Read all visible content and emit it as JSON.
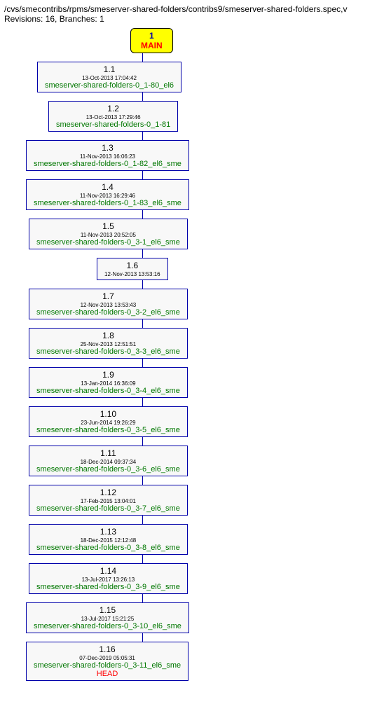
{
  "header": {
    "path": "/cvs/smecontribs/rpms/smeserver-shared-folders/contribs9/smeserver-shared-folders.spec,v",
    "meta": "Revisions: 16, Branches: 1"
  },
  "root": {
    "num": "1",
    "branch": "MAIN"
  },
  "revisions": [
    {
      "rev": "1.1",
      "ts": "13-Oct-2013 17:04:42",
      "tag": "smeserver-shared-folders-0_1-80_el6",
      "head": ""
    },
    {
      "rev": "1.2",
      "ts": "13-Oct-2013 17:29:46",
      "tag": "smeserver-shared-folders-0_1-81",
      "head": ""
    },
    {
      "rev": "1.3",
      "ts": "11-Nov-2013 16:06:23",
      "tag": "smeserver-shared-folders-0_1-82_el6_sme",
      "head": ""
    },
    {
      "rev": "1.4",
      "ts": "11-Nov-2013 16:29:46",
      "tag": "smeserver-shared-folders-0_1-83_el6_sme",
      "head": ""
    },
    {
      "rev": "1.5",
      "ts": "11-Nov-2013 20:52:05",
      "tag": "smeserver-shared-folders-0_3-1_el6_sme",
      "head": ""
    },
    {
      "rev": "1.6",
      "ts": "12-Nov-2013 13:53:16",
      "tag": "",
      "head": ""
    },
    {
      "rev": "1.7",
      "ts": "12-Nov-2013 13:53:43",
      "tag": "smeserver-shared-folders-0_3-2_el6_sme",
      "head": ""
    },
    {
      "rev": "1.8",
      "ts": "25-Nov-2013 12:51:51",
      "tag": "smeserver-shared-folders-0_3-3_el6_sme",
      "head": ""
    },
    {
      "rev": "1.9",
      "ts": "13-Jan-2014 16:36:09",
      "tag": "smeserver-shared-folders-0_3-4_el6_sme",
      "head": ""
    },
    {
      "rev": "1.10",
      "ts": "23-Jun-2014 19:26:29",
      "tag": "smeserver-shared-folders-0_3-5_el6_sme",
      "head": ""
    },
    {
      "rev": "1.11",
      "ts": "18-Dec-2014 09:37:34",
      "tag": "smeserver-shared-folders-0_3-6_el6_sme",
      "head": ""
    },
    {
      "rev": "1.12",
      "ts": "17-Feb-2015 13:04:01",
      "tag": "smeserver-shared-folders-0_3-7_el6_sme",
      "head": ""
    },
    {
      "rev": "1.13",
      "ts": "18-Dec-2015 12:12:48",
      "tag": "smeserver-shared-folders-0_3-8_el6_sme",
      "head": ""
    },
    {
      "rev": "1.14",
      "ts": "13-Jul-2017 13:26:13",
      "tag": "smeserver-shared-folders-0_3-9_el6_sme",
      "head": ""
    },
    {
      "rev": "1.15",
      "ts": "13-Jul-2017 15:21:25",
      "tag": "smeserver-shared-folders-0_3-10_el6_sme",
      "head": ""
    },
    {
      "rev": "1.16",
      "ts": "07-Dec-2019 05:05:31",
      "tag": "smeserver-shared-folders-0_3-11_el6_sme",
      "head": "HEAD"
    }
  ]
}
